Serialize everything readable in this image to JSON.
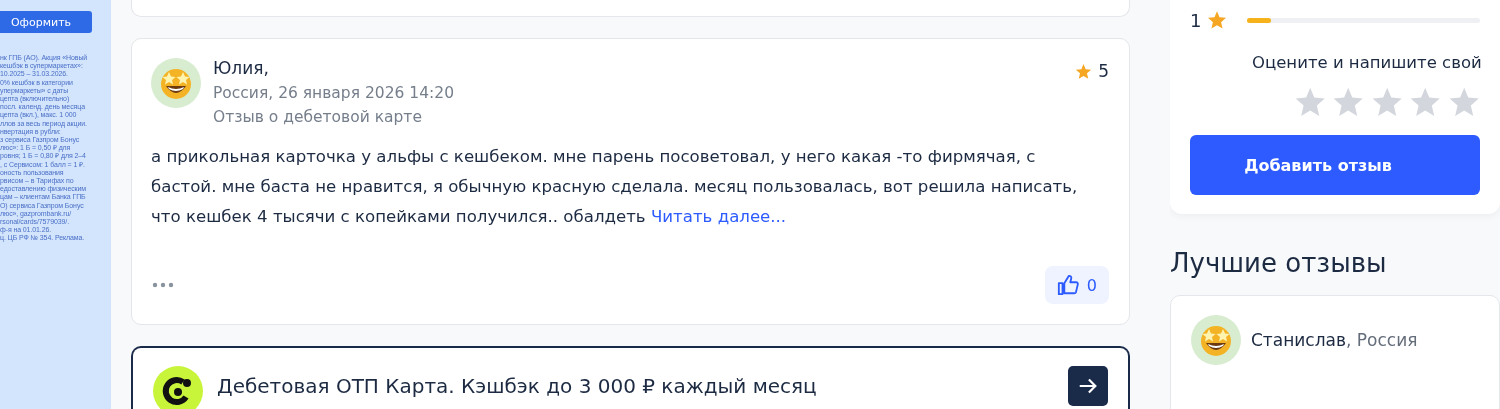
{
  "ad": {
    "button": "Оформить",
    "legal_lines": [
      "нк ГПБ (АО). Акция «Новый",
      "кешбэк в супермаркетах»:",
      "10.2025 – 31.03.2026.",
      "0% кешбэк в категории",
      "упермаркеты» с даты",
      "цепта (включительно)",
      "посл. календ. день месяца",
      "цепта (вкл.), макс. 1 000",
      "ллов за весь период акции.",
      "нвертация в рубли:",
      "з сервиса Газпром Бонус",
      "люс»: 1 Б = 0,50 ₽ для",
      "ровня; 1 Б = 0,80 ₽ для 2–4",
      ", с Сервисом: 1 балл = 1 ₽.",
      "оность пользования",
      "рвисом – в Тарифах по",
      "едоставлению физическим",
      "цам – клиентам Банка ГПБ",
      "О) сервиса Газпром Бонус",
      "люс», gazprombank.ru/",
      "rsonal/cards/7579039/.",
      "ф-я на 01.01.26.",
      "ц. ЦБ РФ № 354. Реклама."
    ]
  },
  "review": {
    "author": "Юлия,",
    "meta": "Россия, 26 января 2026 14:20",
    "subject": "Отзыв о дебетовой карте",
    "rating": "5",
    "text_lines": [
      "а прикольная карточка у альфы с кешбеком. мне парень посоветовал, у него какая -то фирмячая, с",
      "бастой. мне баста не нравится, я обычную красную сделала. месяц пользовалась, вот решила написать,",
      "что кешбек 4 тысячи с копейками получился.. обалдеть"
    ],
    "read_more": "Читать далее...",
    "likes": "0"
  },
  "product": {
    "title": "Дебетовая ОТП Карта. Кэшбэк до 3 000 ₽ каждый месяц"
  },
  "rating_summary": {
    "rows": [
      {
        "label": "1",
        "level": 0.1
      }
    ],
    "prompt": "Оцените и напишите свой",
    "rate": {
      "stars": 0
    },
    "button": "Добавить отзыв"
  },
  "best_reviews": {
    "title": "Лучшие отзывы",
    "items": [
      {
        "author": "Станислав",
        "location": ", Россия"
      }
    ]
  }
}
